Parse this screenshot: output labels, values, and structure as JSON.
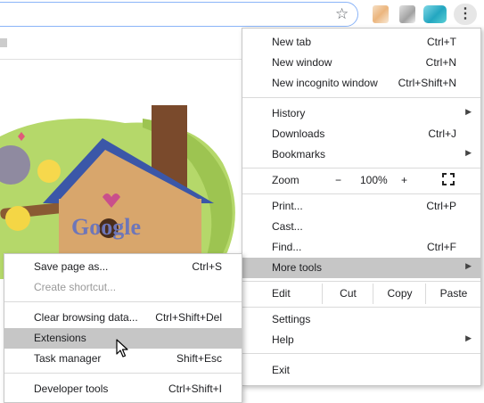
{
  "toolbar": {
    "menu_button": "⋮"
  },
  "main_menu": {
    "new_tab": {
      "label": "New tab",
      "shortcut": "Ctrl+T"
    },
    "new_window": {
      "label": "New window",
      "shortcut": "Ctrl+N"
    },
    "new_incognito": {
      "label": "New incognito window",
      "shortcut": "Ctrl+Shift+N"
    },
    "history": {
      "label": "History"
    },
    "downloads": {
      "label": "Downloads",
      "shortcut": "Ctrl+J"
    },
    "bookmarks": {
      "label": "Bookmarks"
    },
    "zoom": {
      "label": "Zoom",
      "minus": "−",
      "value": "100%",
      "plus": "+"
    },
    "print": {
      "label": "Print...",
      "shortcut": "Ctrl+P"
    },
    "cast": {
      "label": "Cast..."
    },
    "find": {
      "label": "Find...",
      "shortcut": "Ctrl+F"
    },
    "more_tools": {
      "label": "More tools"
    },
    "edit": {
      "label": "Edit",
      "cut": "Cut",
      "copy": "Copy",
      "paste": "Paste"
    },
    "settings": {
      "label": "Settings"
    },
    "help": {
      "label": "Help"
    },
    "exit": {
      "label": "Exit"
    }
  },
  "sub_menu": {
    "save_page": {
      "label": "Save page as...",
      "shortcut": "Ctrl+S"
    },
    "create_shortcut": {
      "label": "Create shortcut..."
    },
    "clear_browsing": {
      "label": "Clear browsing data...",
      "shortcut": "Ctrl+Shift+Del"
    },
    "extensions": {
      "label": "Extensions"
    },
    "task_manager": {
      "label": "Task manager",
      "shortcut": "Shift+Esc"
    },
    "developer_tools": {
      "label": "Developer tools",
      "shortcut": "Ctrl+Shift+I"
    }
  },
  "doodle": {
    "logo_text": "Google"
  }
}
